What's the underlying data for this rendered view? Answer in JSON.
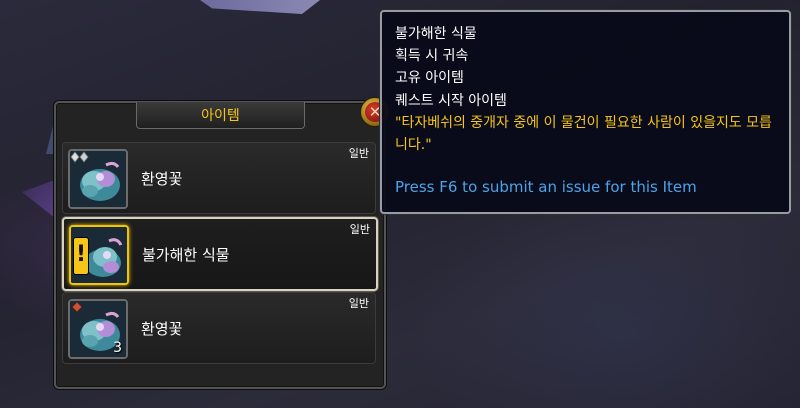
{
  "loot_window": {
    "title": "아이템",
    "close_glyph": "✕",
    "items": [
      {
        "name": "환영꽃",
        "rarity": "일반",
        "quantity": "",
        "icon": "purple-flower-icon",
        "badge": "silver-gem-icon",
        "selected": false
      },
      {
        "name": "불가해한 식물",
        "rarity": "일반",
        "quantity": "",
        "icon": "quest-plant-icon",
        "badge": "quest-exclamation-icon",
        "badge_glyph": "!",
        "selected": true
      },
      {
        "name": "환영꽃",
        "rarity": "일반",
        "quantity": "3",
        "icon": "purple-flower-icon",
        "badge": "red-gem-icon",
        "selected": false
      }
    ]
  },
  "tooltip": {
    "lines": [
      "불가해한 식물",
      "획득 시 귀속",
      "고유 아이템",
      "퀘스트 시작 아이템"
    ],
    "flavor": "\"타자베쉬의 중개자 중에 이 물건이 필요한 사람이 있을지도 모릅니다.\"",
    "help": "Press F6 to submit an issue for this Item"
  },
  "colors": {
    "title_gold": "#f5c518",
    "flavor_gold": "#f5c518",
    "help_blue": "#4aa3e8",
    "text_white": "#ffffff"
  }
}
